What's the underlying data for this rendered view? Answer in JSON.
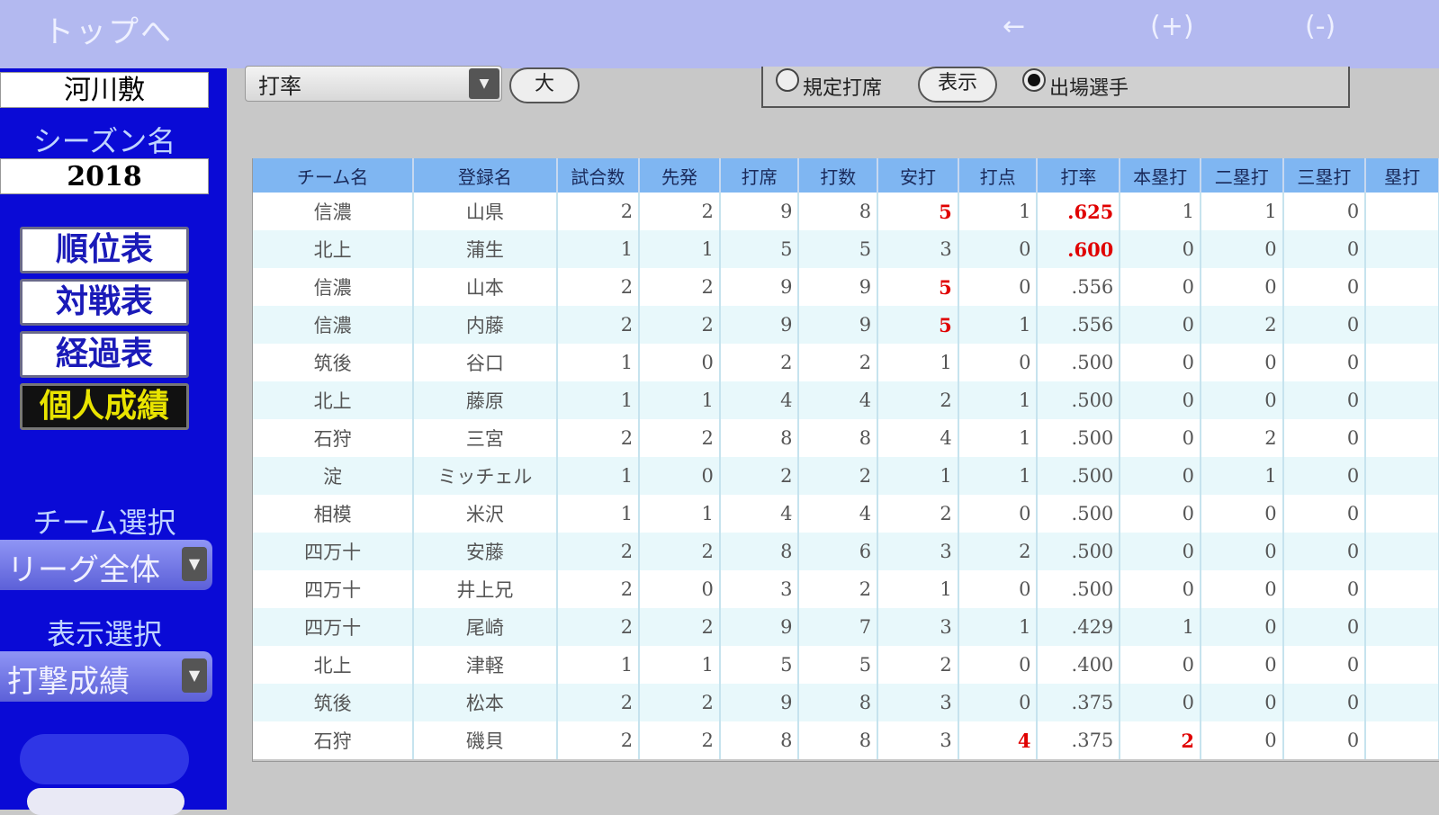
{
  "topbar": {
    "home": "トップへ",
    "back": "←",
    "zoom_in": "(+)",
    "zoom_out": "(-)"
  },
  "sidebar": {
    "league": "河川敷",
    "season_label": "シーズン名",
    "season": "2018",
    "nav": [
      "順位表",
      "対戦表",
      "経過表",
      "個人成績"
    ],
    "team_label": "チーム選択",
    "team_value": "リーグ全体",
    "view_label": "表示選択",
    "view_value": "打撃成績"
  },
  "controls": {
    "sort_value": "打率",
    "size_button": "大",
    "radio1": "規定打席",
    "show_button": "表示",
    "radio2": "出場選手"
  },
  "table": {
    "headers": [
      "チーム名",
      "登録名",
      "試合数",
      "先発",
      "打席",
      "打数",
      "安打",
      "打点",
      "打率",
      "本塁打",
      "二塁打",
      "三塁打",
      "塁打"
    ],
    "rows": [
      [
        "信濃",
        "山県",
        "2",
        "2",
        "9",
        "8",
        "5",
        "1",
        ".625",
        "1",
        "1",
        "0",
        ""
      ],
      [
        "北上",
        "蒲生",
        "1",
        "1",
        "5",
        "5",
        "3",
        "0",
        ".600",
        "0",
        "0",
        "0",
        ""
      ],
      [
        "信濃",
        "山本",
        "2",
        "2",
        "9",
        "9",
        "5",
        "0",
        ".556",
        "0",
        "0",
        "0",
        ""
      ],
      [
        "信濃",
        "内藤",
        "2",
        "2",
        "9",
        "9",
        "5",
        "1",
        ".556",
        "0",
        "2",
        "0",
        ""
      ],
      [
        "筑後",
        "谷口",
        "1",
        "0",
        "2",
        "2",
        "1",
        "0",
        ".500",
        "0",
        "0",
        "0",
        ""
      ],
      [
        "北上",
        "藤原",
        "1",
        "1",
        "4",
        "4",
        "2",
        "1",
        ".500",
        "0",
        "0",
        "0",
        ""
      ],
      [
        "石狩",
        "三宮",
        "2",
        "2",
        "8",
        "8",
        "4",
        "1",
        ".500",
        "0",
        "2",
        "0",
        ""
      ],
      [
        "淀",
        "ミッチェル",
        "1",
        "0",
        "2",
        "2",
        "1",
        "1",
        ".500",
        "0",
        "1",
        "0",
        ""
      ],
      [
        "相模",
        "米沢",
        "1",
        "1",
        "4",
        "4",
        "2",
        "0",
        ".500",
        "0",
        "0",
        "0",
        ""
      ],
      [
        "四万十",
        "安藤",
        "2",
        "2",
        "8",
        "6",
        "3",
        "2",
        ".500",
        "0",
        "0",
        "0",
        ""
      ],
      [
        "四万十",
        "井上兄",
        "2",
        "0",
        "3",
        "2",
        "1",
        "0",
        ".500",
        "0",
        "0",
        "0",
        ""
      ],
      [
        "四万十",
        "尾崎",
        "2",
        "2",
        "9",
        "7",
        "3",
        "1",
        ".429",
        "1",
        "0",
        "0",
        ""
      ],
      [
        "北上",
        "津軽",
        "1",
        "1",
        "5",
        "5",
        "2",
        "0",
        ".400",
        "0",
        "0",
        "0",
        ""
      ],
      [
        "筑後",
        "松本",
        "2",
        "2",
        "9",
        "8",
        "3",
        "0",
        ".375",
        "0",
        "0",
        "0",
        ""
      ],
      [
        "石狩",
        "磯貝",
        "2",
        "2",
        "8",
        "8",
        "3",
        "4",
        ".375",
        "2",
        "0",
        "0",
        ""
      ]
    ],
    "highlight": [
      [
        0,
        6
      ],
      [
        0,
        8
      ],
      [
        1,
        8
      ],
      [
        2,
        6
      ],
      [
        3,
        6
      ],
      [
        14,
        7
      ],
      [
        14,
        9
      ]
    ]
  }
}
